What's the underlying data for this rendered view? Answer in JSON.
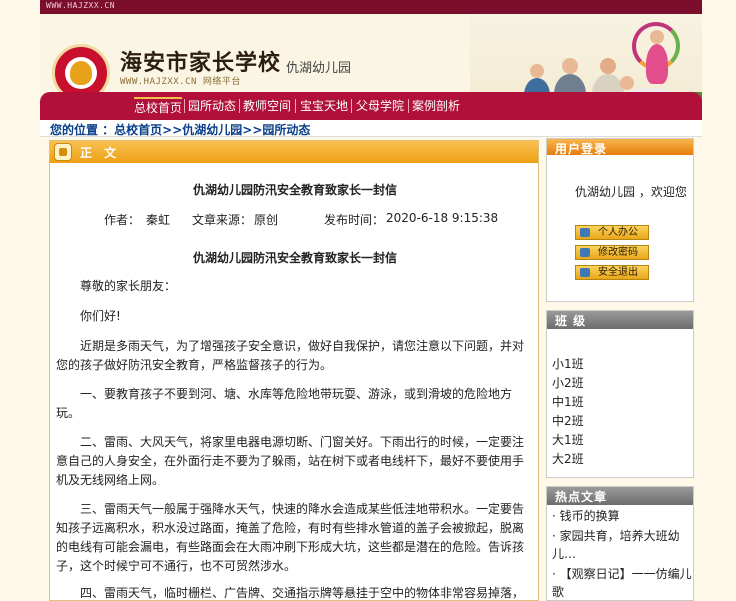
{
  "site": {
    "url_top": "WWW.HAJZXX.CN",
    "title": "海安市家长学校",
    "subtitle": "仇湖幼儿园",
    "url_sub": "WWW.HAJZXX.CN 网络平台"
  },
  "nav": {
    "items": [
      {
        "label": "总校首页"
      },
      {
        "label": "园所动态"
      },
      {
        "label": "教师空间"
      },
      {
        "label": "宝宝天地"
      },
      {
        "label": "父母学院"
      },
      {
        "label": "案例剖析"
      }
    ]
  },
  "breadcrumb": {
    "text": "您的位置 ：总校首页>>仇湖幼儿园>>园所动态"
  },
  "article": {
    "section_label": "正 文",
    "title": "仇湖幼儿园防汛安全教育致家长一封信",
    "author_label": "作者：",
    "author": "秦虹",
    "source_label": "文章来源：",
    "source": "原创",
    "time_label": "发布时间：",
    "time": "2020-6-18 9:15:38",
    "content_title": "仇湖幼儿园防汛安全教育致家长一封信",
    "paragraphs": [
      "尊敬的家长朋友：",
      "你们好!",
      "近期是多雨天气，为了增强孩子安全意识，做好自我保护，请您注意以下问题，并对您的孩子做好防汛安全教育，严格监督孩子的行为。",
      "一、要教育孩子不要到河、塘、水库等危险地带玩耍、游泳，或到滑坡的危险地方玩。",
      "二、雷雨、大风天气，将家里电器电源切断、门窗关好。下雨出行的时候，一定要注意自己的人身安全，在外面行走不要为了躲雨，站在树下或者电线杆下，最好不要使用手机及无线网络上网。",
      "三、雷雨天气一般属于强降水天气，快速的降水会造成某些低洼地带积水。一定要告知孩子远离积水，积水没过路面，掩盖了危险，有时有些排水管道的盖子会被掀起，脱离的电线有可能会漏电，有些路面会在大雨冲刷下形成大坑，这些都是潜在的危险。告诉孩子，这个时候宁可不通行，也不可贸然涉水。",
      "四、雷雨天气，临时栅栏、广告牌、交通指示牌等悬挂于空中的物体非常容易掉落，"
    ]
  },
  "login": {
    "title": "用户登录",
    "welcome": "仇湖幼儿园 ，欢迎您",
    "buttons": [
      {
        "label": "个人办公"
      },
      {
        "label": "修改密码"
      },
      {
        "label": "安全退出"
      }
    ]
  },
  "classes": {
    "title": "班  级",
    "items": [
      "小1班",
      "小2班",
      "中1班",
      "中2班",
      "大1班",
      "大2班"
    ]
  },
  "hot": {
    "title": "热点文章",
    "items": [
      "钱币的换算",
      "家园共育，培养大班幼儿…",
      "【观察日记】一一仿编儿歌"
    ]
  }
}
